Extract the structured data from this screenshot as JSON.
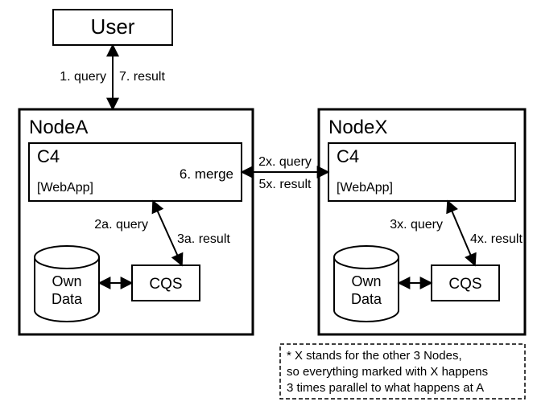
{
  "user_box": {
    "label": "User"
  },
  "nodeA": {
    "title": "NodeA",
    "c4": {
      "title": "C4",
      "subtitle": "[WebApp]",
      "merge": "6. merge"
    },
    "cqs": {
      "label": "CQS"
    },
    "own_data": {
      "line1": "Own",
      "line2": "Data"
    }
  },
  "nodeX": {
    "title": "NodeX",
    "c4": {
      "title": "C4",
      "subtitle": "[WebApp]"
    },
    "cqs": {
      "label": "CQS"
    },
    "own_data": {
      "line1": "Own",
      "line2": "Data"
    }
  },
  "edges": {
    "e1": "1. query",
    "e7": "7. result",
    "e2a": "2a. query",
    "e3a": "3a. result",
    "e2x": "2x. query",
    "e5x": "5x. result",
    "e3x": "3x. query",
    "e4x": "4x. result"
  },
  "footnote": {
    "l1": "* X stands for the other 3 Nodes,",
    "l2": "so everything marked with X happens",
    "l3": "3 times parallel to what happens at A"
  }
}
